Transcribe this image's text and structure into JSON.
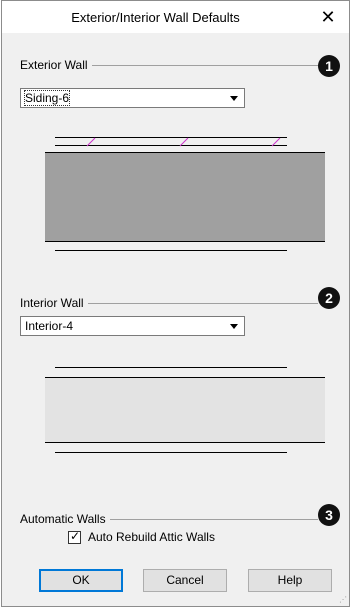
{
  "dialog": {
    "title": "Exterior/Interior Wall Defaults",
    "close_glyph": "✕"
  },
  "exterior": {
    "label": "Exterior Wall",
    "badge": "1",
    "select_value": "Siding-6",
    "fill_color": "#a0a0a0",
    "hatch_color": "#cc33cc"
  },
  "interior": {
    "label": "Interior Wall",
    "badge": "2",
    "select_value": "Interior-4",
    "fill_color": "#e3e3e3"
  },
  "automatic": {
    "label": "Automatic Walls",
    "badge": "3",
    "checkbox_label": "Auto Rebuild Attic Walls",
    "checked": true
  },
  "buttons": {
    "ok": "OK",
    "cancel": "Cancel",
    "help": "Help"
  },
  "colors": {
    "accent": "#0078d7",
    "dialog_bg": "#f0f0f0"
  }
}
